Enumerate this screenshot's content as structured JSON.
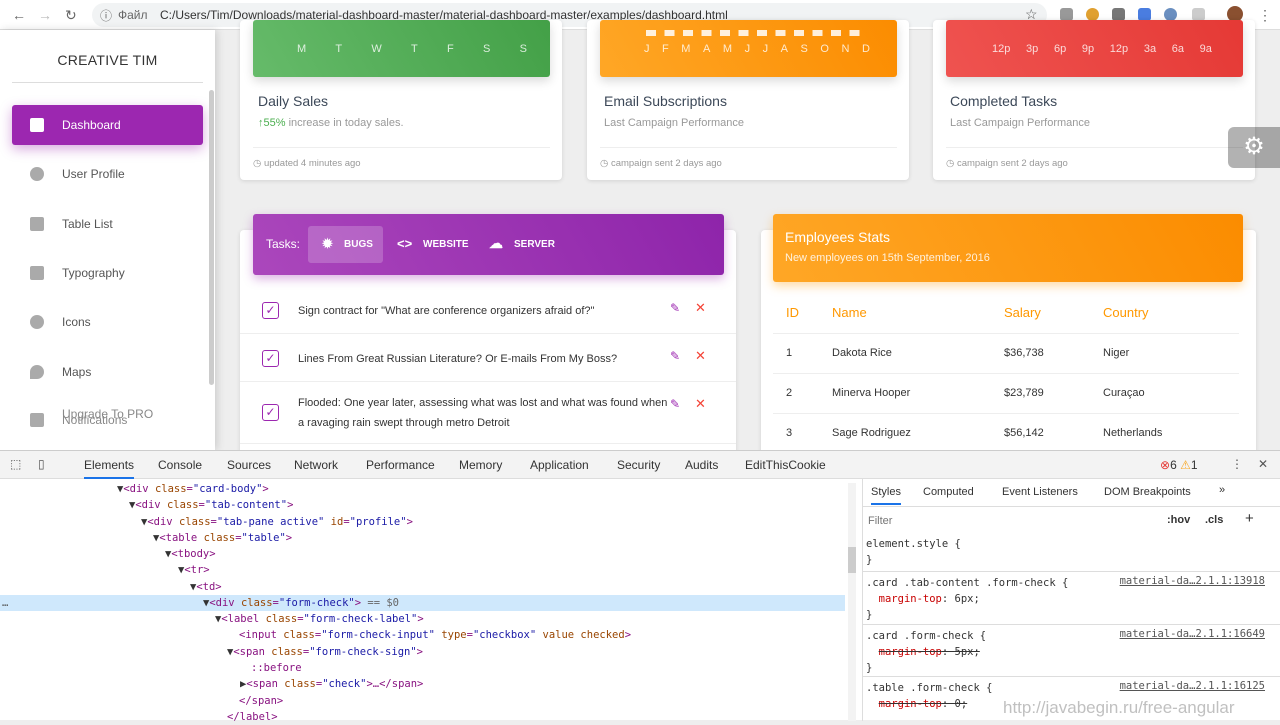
{
  "browser": {
    "file_label": "Файл",
    "url": "C:/Users/Tim/Downloads/material-dashboard-master/material-dashboard-master/examples/dashboard.html"
  },
  "sidebar": {
    "brand": "CREATIVE TIM",
    "items": [
      {
        "label": "Dashboard",
        "icon": "dashboard-icon",
        "active": true
      },
      {
        "label": "User Profile",
        "icon": "person-icon"
      },
      {
        "label": "Table List",
        "icon": "clipboard-icon"
      },
      {
        "label": "Typography",
        "icon": "library-books-icon"
      },
      {
        "label": "Icons",
        "icon": "bubble-chart-icon"
      },
      {
        "label": "Maps",
        "icon": "location-icon"
      },
      {
        "label": "Notifications",
        "icon": "notifications-icon"
      },
      {
        "label": "Upgrade To PRO",
        "icon": "unarchive-icon"
      }
    ]
  },
  "stat_cards": [
    {
      "labels": [
        "M",
        "T",
        "W",
        "T",
        "F",
        "S",
        "S"
      ],
      "color": "#4caf50",
      "title": "Daily Sales",
      "sub_highlight": "55%",
      "sub": " increase in today sales.",
      "footer": "updated 4 minutes ago"
    },
    {
      "labels": [
        "J",
        "F",
        "M",
        "A",
        "M",
        "J",
        "J",
        "A",
        "S",
        "O",
        "N",
        "D"
      ],
      "color": "#ff9800",
      "title": "Email Subscriptions",
      "sub": "Last Campaign Performance",
      "footer": "campaign sent 2 days ago"
    },
    {
      "labels": [
        "12p",
        "3p",
        "6p",
        "9p",
        "12p",
        "3a",
        "6a",
        "9a"
      ],
      "color": "#f44336",
      "title": "Completed Tasks",
      "sub": "Last Campaign Performance",
      "footer": "campaign sent 2 days ago"
    }
  ],
  "tasks": {
    "label": "Tasks:",
    "tabs": [
      "BUGS",
      "WEBSITE",
      "SERVER"
    ],
    "items": [
      "Sign contract for \"What are conference organizers afraid of?\"",
      "Lines From Great Russian Literature? Or E-mails From My Boss?",
      "Flooded: One year later, assessing what was lost and what was found when a ravaging rain swept through metro Detroit"
    ]
  },
  "employees": {
    "title": "Employees Stats",
    "subtitle": "New employees on 15th September, 2016",
    "columns": [
      "ID",
      "Name",
      "Salary",
      "Country"
    ],
    "rows": [
      [
        "1",
        "Dakota Rice",
        "$36,738",
        "Niger"
      ],
      [
        "2",
        "Minerva Hooper",
        "$23,789",
        "Curaçao"
      ],
      [
        "3",
        "Sage Rodriguez",
        "$56,142",
        "Netherlands"
      ]
    ]
  },
  "devtools": {
    "tabs": [
      "Elements",
      "Console",
      "Sources",
      "Network",
      "Performance",
      "Memory",
      "Application",
      "Security",
      "Audits",
      "EditThisCookie"
    ],
    "errors": "6",
    "warnings": "1",
    "side_tabs": [
      "Styles",
      "Computed",
      "Event Listeners",
      "DOM Breakpoints"
    ],
    "filter_placeholder": "Filter",
    "hov": ":hov",
    "cls": ".cls",
    "rules": [
      {
        "sel": "element.style {",
        "src": ""
      },
      {
        "sel": ".card .tab-content .form-check {",
        "prop": "margin-top",
        "val": "6px;",
        "src": "material-da…2.1.1:13918",
        "struck": false
      },
      {
        "sel": ".card .form-check {",
        "prop": "margin-top",
        "val": "5px;",
        "src": "material-da…2.1.1:16649",
        "struck": true
      },
      {
        "sel": ".table .form-check {",
        "prop": "margin-top",
        "val": "0;",
        "src": "material-da…2.1.1:16125",
        "struck": true
      }
    ]
  },
  "watermark": "http://javabegin.ru/free-angular"
}
